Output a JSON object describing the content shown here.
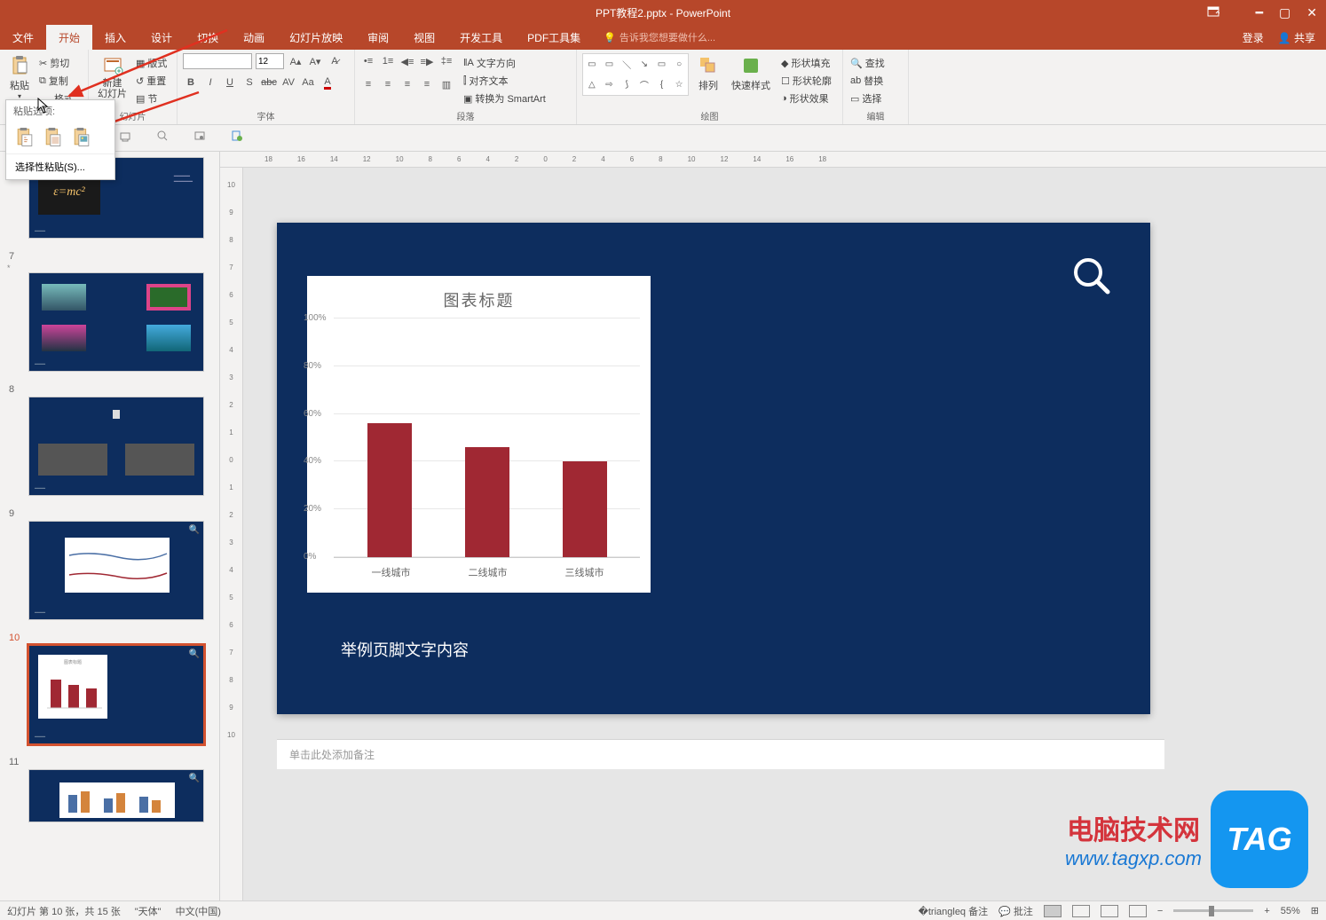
{
  "app": {
    "title": "PPT教程2.pptx - PowerPoint"
  },
  "tabs": {
    "file": "文件",
    "home": "开始",
    "insert": "插入",
    "design": "设计",
    "transitions": "切换",
    "animations": "动画",
    "slideshow": "幻灯片放映",
    "review": "审阅",
    "view": "视图",
    "developer": "开发工具",
    "pdf": "PDF工具集",
    "tell_me": "告诉我您想要做什么...",
    "login": "登录",
    "share": "共享"
  },
  "ribbon": {
    "clipboard": {
      "paste": "粘贴",
      "cut": "剪切",
      "copy": "复制",
      "format_painter": "格式刷",
      "dropdown_header": "粘贴选项:",
      "special_paste": "选择性粘贴(S)..."
    },
    "slides": {
      "new_slide": "新建\n幻灯片",
      "layout": "版式",
      "reset": "重置",
      "section": "节",
      "group": "幻灯片"
    },
    "font": {
      "size": "12",
      "group": "字体"
    },
    "paragraph": {
      "text_direction": "文字方向",
      "align_text": "对齐文本",
      "convert_smartart": "转换为 SmartArt",
      "group": "段落"
    },
    "drawing": {
      "arrange": "排列",
      "quick_styles": "快速样式",
      "shape_fill": "形状填充",
      "shape_outline": "形状轮廓",
      "shape_effects": "形状效果",
      "group": "绘图"
    },
    "editing": {
      "find": "查找",
      "replace": "替换",
      "select": "选择",
      "group": "编辑"
    }
  },
  "thumbs": {
    "n6_star": "*",
    "n7": "7",
    "n8": "8",
    "n9": "9",
    "n10": "10",
    "n11": "11"
  },
  "slide": {
    "footer_text": "举例页脚文字内容",
    "notes_placeholder": "单击此处添加备注"
  },
  "chart_data": {
    "type": "bar",
    "title": "图表标题",
    "categories": [
      "一线城市",
      "二线城市",
      "三线城市"
    ],
    "values": [
      56,
      46,
      40
    ],
    "ylabel": "",
    "xlabel": "",
    "ylim": [
      0,
      100
    ],
    "yticks": [
      "0%",
      "20%",
      "40%",
      "60%",
      "80%",
      "100%"
    ]
  },
  "status": {
    "slide_info": "幻灯片 第 10 张，共 15 张",
    "theme": "\"天体\"",
    "lang": "中文(中国)",
    "notes": "备注",
    "comments": "批注",
    "zoom": "55%"
  },
  "watermark": {
    "line1": "电脑技术网",
    "line2": "www.tagxp.com",
    "tag": "TAG"
  }
}
